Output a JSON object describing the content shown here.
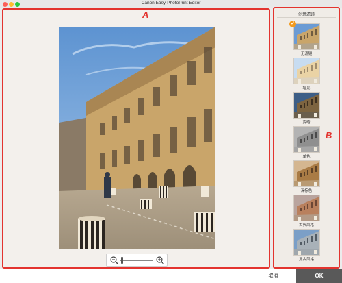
{
  "window": {
    "title": "Canon Easy-PhotoPrint Editor"
  },
  "callouts": {
    "a": "A",
    "b": "B"
  },
  "preview": {
    "zoom_level": 0.05
  },
  "filter_panel": {
    "title": "创意滤镜",
    "selected_index": 0,
    "items": [
      {
        "label": "无滤镜",
        "tone": "original"
      },
      {
        "label": "增亮",
        "tone": "brighten"
      },
      {
        "label": "变暗",
        "tone": "darken"
      },
      {
        "label": "单色",
        "tone": "monochrome"
      },
      {
        "label": "深棕色",
        "tone": "sepia"
      },
      {
        "label": "古典风格",
        "tone": "vintage"
      },
      {
        "label": "复古风格",
        "tone": "retro"
      }
    ]
  },
  "footer": {
    "cancel_label": "取消",
    "ok_label": "OK"
  },
  "colors": {
    "callout_red": "#e3342f",
    "check_orange": "#f39a1d",
    "ok_button": "#595959"
  }
}
